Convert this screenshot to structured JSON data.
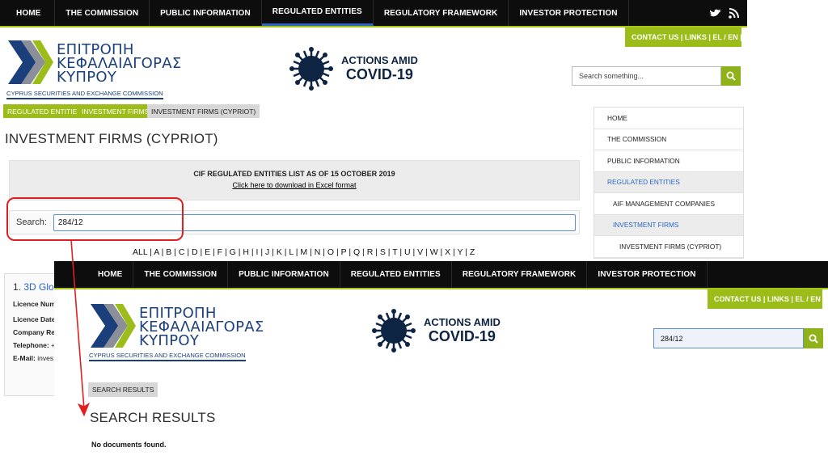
{
  "back": {
    "nav": [
      "HOME",
      "THE COMMISSION",
      "PUBLIC INFORMATION",
      "REGULATED ENTITIES",
      "REGULATORY FRAMEWORK",
      "INVESTOR PROTECTION"
    ],
    "util": "CONTACT US  |  LINKS  |   EL / EN |",
    "logo_lines": [
      "ΕΠΙΤΡΟΠΗ",
      "ΚΕΦΑΛΑΙΑΓΟΡΑΣ",
      "ΚΥΠΡΟΥ"
    ],
    "logo_sub": "CYPRUS SECURITIES AND EXCHANGE COMMISSION",
    "covid_l1": "ACTIONS AMID",
    "covid_l2": "COVID-19",
    "search_placeholder": "Search something...",
    "breadcrumb": [
      "REGULATED ENTITIES",
      "INVESTMENT FIRMS",
      "INVESTMENT FIRMS (CYPRIOT)"
    ],
    "page_title": "INVESTMENT FIRMS (CYPRIOT)",
    "list_title": "CIF REGULATED ENTITIES LIST AS OF 15 OCTOBER 2019",
    "list_link": "Click here to download in Excel format",
    "search_label": "Search:",
    "search_value": "284/12",
    "alphabet": "ALL | A | B | C | D | E | F | G | H | I | J | K | L | M | N | O | P | Q | R | S | T | U | V | W | X | Y | Z",
    "side_menu": [
      "HOME",
      "THE COMMISSION",
      "PUBLIC INFORMATION",
      "REGULATED ENTITIES",
      "AIF MANAGEMENT COMPANIES",
      "INVESTMENT FIRMS",
      "INVESTMENT FIRMS (CYPRIOT)"
    ],
    "result": {
      "num": "1.",
      "name": "3D Glob",
      "fields": [
        {
          "label": "Licence Num",
          "value": ""
        },
        {
          "label": "Licence Date",
          "value": ""
        },
        {
          "label": "Company Re",
          "value": ""
        },
        {
          "label": "Telephone:",
          "value": " +"
        },
        {
          "label": "E-Mail:",
          "value": " inves"
        }
      ]
    }
  },
  "front": {
    "nav": [
      "HOME",
      "THE COMMISSION",
      "PUBLIC INFORMATION",
      "REGULATED ENTITIES",
      "REGULATORY FRAMEWORK",
      "INVESTOR PROTECTION"
    ],
    "util": "CONTACT US  |  LINKS  |   EL / EN |",
    "logo_lines": [
      "ΕΠΙΤΡΟΠΗ",
      "ΚΕΦΑΛΑΙΑΓΟΡΑΣ",
      "ΚΥΠΡΟΥ"
    ],
    "logo_sub": "CYPRUS SECURITIES AND EXCHANGE COMMISSION",
    "covid_l1": "ACTIONS AMID",
    "covid_l2": "COVID-19",
    "search_value": "284/12",
    "breadcrumb": "SEARCH RESULTS",
    "title": "SEARCH RESULTS",
    "message": "No documents found."
  },
  "colors": {
    "green": "#9cbc1a",
    "navy": "#1b3f7a",
    "nav_bg": "#0d0d0d",
    "annotation": "#e02020"
  }
}
